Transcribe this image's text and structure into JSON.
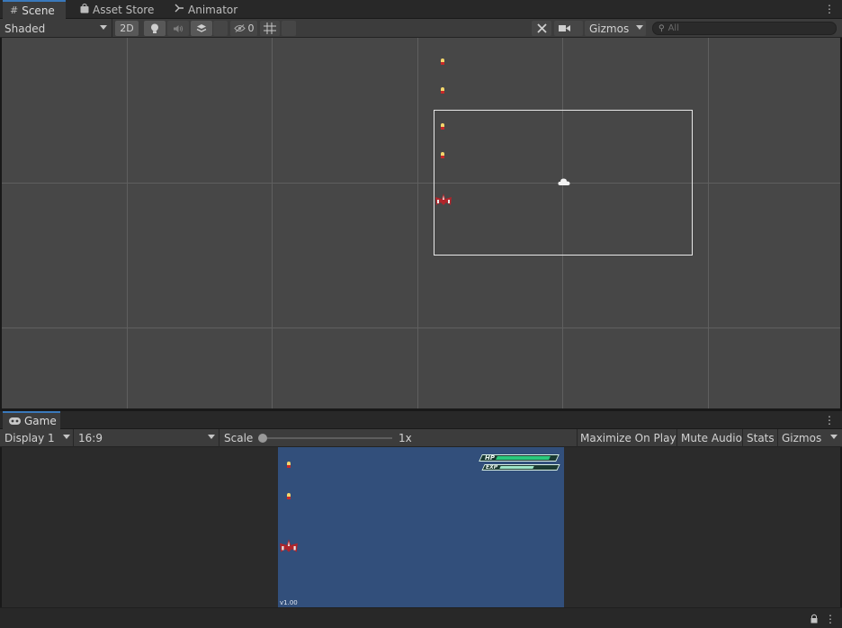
{
  "scene_tabs": [
    {
      "label": "Scene",
      "icon": "grid-icon",
      "active": true
    },
    {
      "label": "Asset Store",
      "icon": "bag-icon",
      "active": false
    },
    {
      "label": "Animator",
      "icon": "animator-icon",
      "active": false
    }
  ],
  "scene_toolbar": {
    "draw_mode": "Shaded",
    "mode_2d": "2D",
    "hidden_count": "0",
    "gizmos": "Gizmos",
    "search_placeholder": "All"
  },
  "game_tab": {
    "label": "Game",
    "icon": "gamepad-icon"
  },
  "game_toolbar": {
    "display": "Display 1",
    "aspect": "16:9",
    "scale_label": "Scale",
    "scale_value": "1x",
    "scale_fraction": 0.0,
    "maximize_on_play": "Maximize On Play",
    "mute_audio": "Mute Audio",
    "stats": "Stats",
    "gizmos": "Gizmos"
  },
  "game": {
    "hp_label": "HP",
    "exp_label": "EXP",
    "hp_fraction": 0.92,
    "exp_fraction": 0.62,
    "version": "v1.00"
  },
  "colors": {
    "accent": "#3a79bb",
    "scene_bg": "#474747",
    "game_bg": "#324f7b",
    "hp_fill": "#2bc97d",
    "exp_fill": "#9fe6c8"
  }
}
